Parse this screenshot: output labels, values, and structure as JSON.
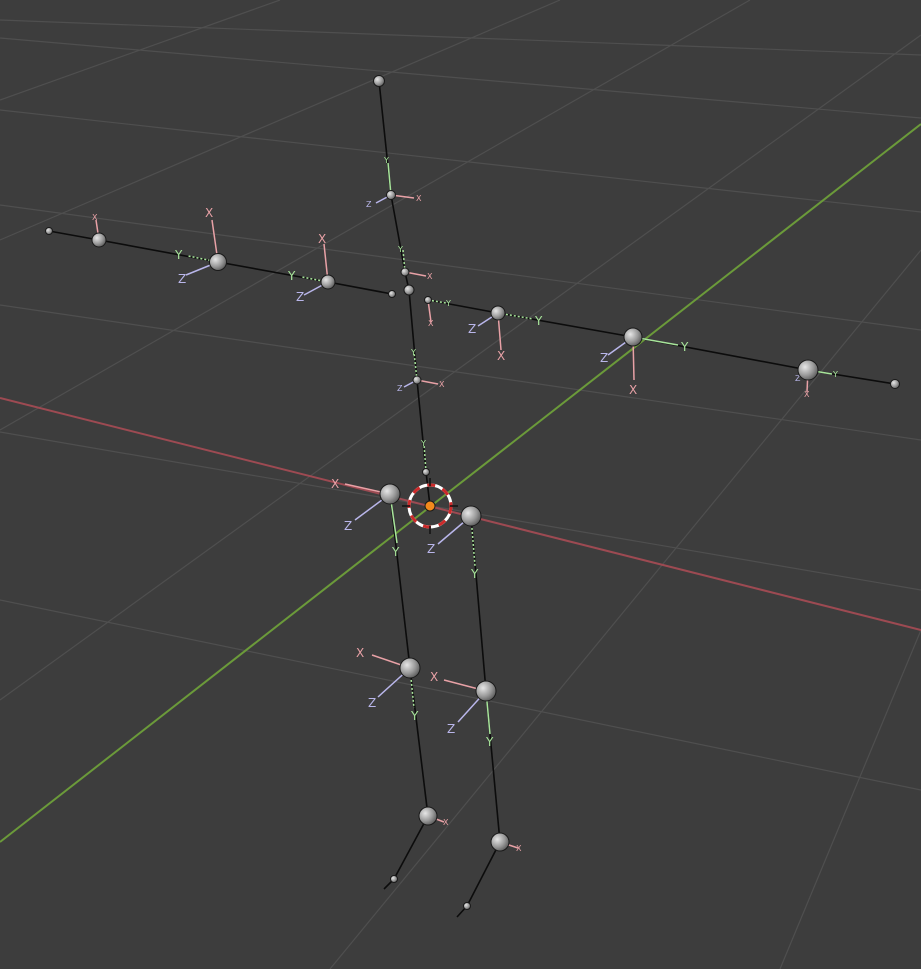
{
  "viewport": {
    "background": "#3d3d3d",
    "grid_color": "#4f4f4f",
    "x_axis_color": "#9d4a52",
    "y_axis_color": "#6b9a3a",
    "bone_color": "#0c0c0c",
    "joint_color": "#b9b9b9",
    "axis_x_color": "#e8a1a6",
    "axis_y_color": "#a8e59b",
    "axis_z_color": "#b9b6ea",
    "cursor_color": "#cc2a2a",
    "origin_color": "#f28a1c"
  },
  "labels": {
    "x": "X",
    "y": "Y",
    "z": "Z"
  },
  "icons": [
    "3d-cursor-icon",
    "origin-icon"
  ]
}
